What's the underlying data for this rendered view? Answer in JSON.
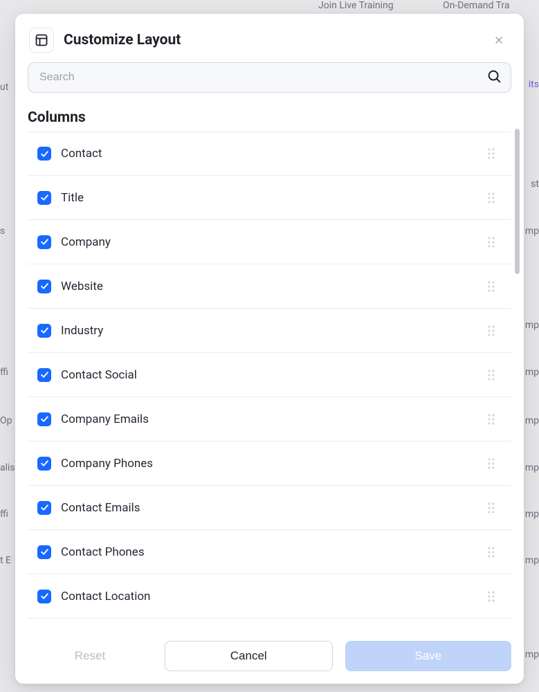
{
  "background": {
    "topBtn1": "Join Live Training",
    "topBtn2": "On-Demand Tra",
    "leftFrag0": "ut",
    "leftFrag1": "s",
    "leftFrag2": "ffi",
    "leftFrag3": "Op",
    "leftFrag4": "alis",
    "leftFrag5": "ffi",
    "leftFrag6": "t E",
    "rightFrag0": "its",
    "rightFrag1": "st",
    "rightFrag2": "mp",
    "rightFrag3": "mp",
    "rightFrag4": "mp",
    "rightFrag5": "mp",
    "rightFrag6": "mp",
    "rightFrag7": "mp",
    "rightFrag8": "mp",
    "rightFrag9": "mp"
  },
  "modal": {
    "title": "Customize Layout",
    "searchPlaceholder": "Search",
    "sectionTitle": "Columns",
    "items": [
      {
        "label": "Contact",
        "checked": true
      },
      {
        "label": "Title",
        "checked": true
      },
      {
        "label": "Company",
        "checked": true
      },
      {
        "label": "Website",
        "checked": true
      },
      {
        "label": "Industry",
        "checked": true
      },
      {
        "label": "Contact Social",
        "checked": true
      },
      {
        "label": "Company Emails",
        "checked": true
      },
      {
        "label": "Company Phones",
        "checked": true
      },
      {
        "label": "Contact Emails",
        "checked": true
      },
      {
        "label": "Contact Phones",
        "checked": true
      },
      {
        "label": "Contact Location",
        "checked": true
      }
    ],
    "buttons": {
      "reset": "Reset",
      "cancel": "Cancel",
      "save": "Save"
    }
  },
  "colors": {
    "accent": "#1769ff",
    "saveBg": "#c0d3f9"
  }
}
